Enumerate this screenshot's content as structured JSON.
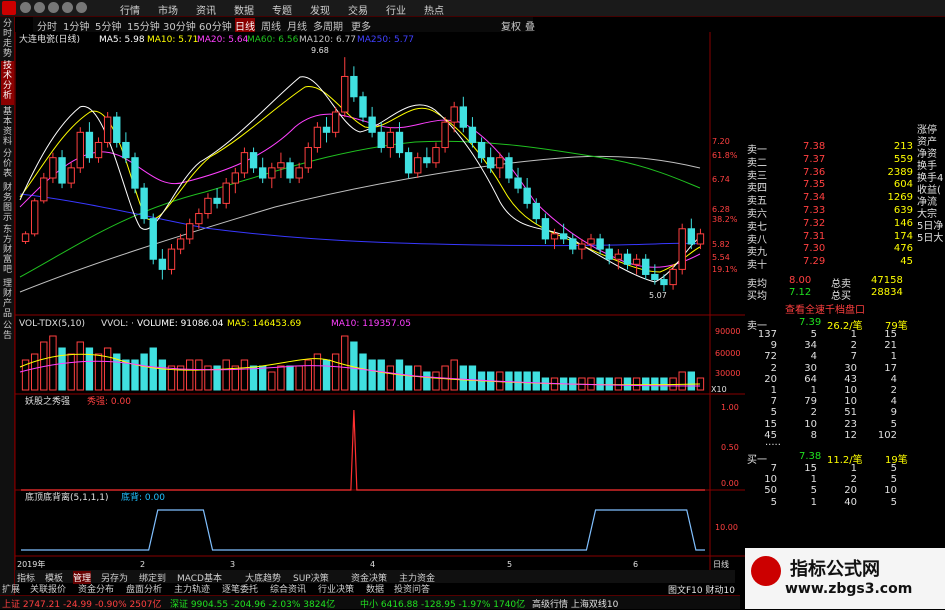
{
  "menubar": {
    "items": [
      "行情",
      "市场",
      "资讯",
      "数据",
      "专题",
      "发现",
      "交易",
      "行业",
      "热点"
    ]
  },
  "periods": {
    "items": [
      "分时",
      "1分钟",
      "5分钟",
      "15分钟",
      "30分钟",
      "60分钟",
      "日线",
      "周线",
      "月线",
      "多周期",
      "更多"
    ],
    "active": "日线",
    "right": [
      "复权",
      "叠"
    ]
  },
  "side_tabs": [
    "分时走势",
    "技术分析",
    "基本资料",
    "分价表",
    "财务图示",
    "东方财富吧",
    "理财产品",
    "公告"
  ],
  "main_chart": {
    "title": "大连电瓷(日线)",
    "ma": [
      {
        "label": "MA5: 5.98",
        "color": "#ffffff"
      },
      {
        "label": "MA10: 5.71",
        "color": "#ffff00"
      },
      {
        "label": "MA20: 5.64",
        "color": "#ff40ff"
      },
      {
        "label": "MA60: 6.56",
        "color": "#20c020"
      },
      {
        "label": "MA120: 6.77",
        "color": "#c0c0c0"
      },
      {
        "label": "MA250: 5.77",
        "color": "#4040ff"
      }
    ],
    "price_axis": [
      "7.20",
      "6.74",
      "6.28",
      "5.82",
      "5.54"
    ],
    "pct_axis": [
      "61.8%",
      "38.2%",
      "19.1%"
    ],
    "high_label": "9.68",
    "low_label": "5.07"
  },
  "volume_panel": {
    "title": "VOL-TDX(5,10)",
    "vvol": "VVOL: ·",
    "volume": "VOLUME: 91086.04",
    "ma5": "MA5: 146453.69",
    "ma10": "MA10: 119357.05",
    "axis": [
      "90000",
      "60000",
      "30000",
      "X10"
    ]
  },
  "panel2": {
    "title": "妖股之秀强",
    "value": "秀强: 0.00",
    "axis": [
      "1.00",
      "0.50",
      "0.00"
    ]
  },
  "panel3": {
    "title": "底顶底背离(5,1,1,1)",
    "value": "底背: 0.00",
    "axis": [
      "10.00"
    ]
  },
  "time_axis": {
    "labels": [
      "2019年",
      "2",
      "3",
      "4",
      "5",
      "6"
    ],
    "right": "日线"
  },
  "bottom_tabs": [
    "指标",
    "模板",
    "管理",
    "另存为",
    "绑定到",
    "MACD基本",
    "大底趋势",
    "SUP决策",
    "资金决策",
    "主力资金",
    "扩展",
    "关联报价",
    "资金分布",
    "盘面分析",
    "主力轨迹",
    "逐笔委托",
    "综合资讯",
    "行业决策",
    "数据",
    "投资问答"
  ],
  "right_panel": {
    "side_labels": [
      "涨停",
      "资产",
      "净资",
      "换手",
      "换手4",
      "收益(",
      "净流",
      "大宗",
      "5日净",
      "5日大"
    ],
    "sell": [
      {
        "label": "卖一",
        "price": "7.38",
        "vol": "213"
      },
      {
        "label": "卖二",
        "price": "7.37",
        "vol": "559"
      },
      {
        "label": "卖三",
        "price": "7.36",
        "vol": "2389"
      },
      {
        "label": "卖四",
        "price": "7.35",
        "vol": "604"
      },
      {
        "label": "卖五",
        "price": "7.34",
        "vol": "1269"
      },
      {
        "label": "卖六",
        "price": "7.33",
        "vol": "639"
      },
      {
        "label": "卖七",
        "price": "7.32",
        "vol": "146"
      },
      {
        "label": "卖八",
        "price": "7.31",
        "vol": "174"
      },
      {
        "label": "卖九",
        "price": "7.30",
        "vol": "476"
      },
      {
        "label": "卖十",
        "price": "7.29",
        "vol": "45"
      }
    ],
    "avg_sell": {
      "label": "卖均",
      "price": "8.00",
      "total_label": "总卖",
      "total": "47158"
    },
    "avg_buy": {
      "label": "买均",
      "price": "7.12",
      "total_label": "总买",
      "total": "28834"
    },
    "link": "查看全速千档盘口",
    "ask_header": {
      "label": "卖一",
      "price": "7.39",
      "frac": "26.2/笔",
      "count": "79笔"
    },
    "ask_queue": [
      [
        "137",
        "5",
        "1",
        "15"
      ],
      [
        "9",
        "34",
        "2",
        "21"
      ],
      [
        "72",
        "4",
        "7",
        "1"
      ],
      [
        "2",
        "30",
        "30",
        "17"
      ],
      [
        "20",
        "64",
        "43",
        "4"
      ],
      [
        "1",
        "1",
        "10",
        "2"
      ],
      [
        "7",
        "79",
        "10",
        "4"
      ],
      [
        "5",
        "2",
        "51",
        "9"
      ],
      [
        "15",
        "10",
        "23",
        "5"
      ],
      [
        "45",
        "8",
        "12",
        "102"
      ]
    ],
    "ellipsis": ".....",
    "bid_header": {
      "label": "买一",
      "price": "7.38",
      "frac": "11.2/笔",
      "count": "19笔"
    },
    "bid_queue": [
      [
        "7",
        "15",
        "1",
        "5"
      ],
      [
        "10",
        "1",
        "2",
        "5"
      ],
      [
        "50",
        "5",
        "20",
        "10"
      ],
      [
        "5",
        "1",
        "40",
        "5"
      ]
    ]
  },
  "status_bar": {
    "sh": "上证 2747.21 -24.99 -0.90% 2507亿",
    "sz": "深证 9904.55 -204.96 -2.03% 3824亿",
    "zx": "中小 6416.88 -128.95 -1.97% 1740亿",
    "right": "高级行情 上海双线10",
    "f10": "图文F10 财动10"
  },
  "watermark": {
    "title": "指标公式网",
    "url": "www.zbgs3.com"
  },
  "chart_data": {
    "type": "candlestick",
    "title": "大连电瓷(日线)",
    "ylim": [
      4.7,
      9.9
    ],
    "high": 9.68,
    "low": 5.07,
    "up_color": "#ff4040",
    "down_color": "#40e0e0",
    "ohlc": [
      [
        6.05,
        6.25,
        6.0,
        6.2
      ],
      [
        6.2,
        6.9,
        6.15,
        6.85
      ],
      [
        6.85,
        7.4,
        6.8,
        7.3
      ],
      [
        7.3,
        7.8,
        7.2,
        7.7
      ],
      [
        7.7,
        7.85,
        7.1,
        7.2
      ],
      [
        7.2,
        7.6,
        7.1,
        7.5
      ],
      [
        7.5,
        8.3,
        7.4,
        8.2
      ],
      [
        8.2,
        8.4,
        7.6,
        7.7
      ],
      [
        7.7,
        8.1,
        7.6,
        8.0
      ],
      [
        8.0,
        8.6,
        7.9,
        8.5
      ],
      [
        8.5,
        8.6,
        7.9,
        8.0
      ],
      [
        8.0,
        8.2,
        7.6,
        7.7
      ],
      [
        7.7,
        7.8,
        7.0,
        7.1
      ],
      [
        7.1,
        7.2,
        6.4,
        6.5
      ],
      [
        6.5,
        6.6,
        5.6,
        5.7
      ],
      [
        5.7,
        5.9,
        5.3,
        5.5
      ],
      [
        5.5,
        6.0,
        5.4,
        5.9
      ],
      [
        5.9,
        6.2,
        5.8,
        6.1
      ],
      [
        6.1,
        6.5,
        6.0,
        6.4
      ],
      [
        6.4,
        6.7,
        6.3,
        6.6
      ],
      [
        6.6,
        7.0,
        6.5,
        6.9
      ],
      [
        6.9,
        7.1,
        6.7,
        6.8
      ],
      [
        6.8,
        7.3,
        6.7,
        7.2
      ],
      [
        7.2,
        7.5,
        7.0,
        7.4
      ],
      [
        7.4,
        7.9,
        7.3,
        7.8
      ],
      [
        7.8,
        7.9,
        7.4,
        7.5
      ],
      [
        7.5,
        7.7,
        7.2,
        7.3
      ],
      [
        7.3,
        7.6,
        7.1,
        7.5
      ],
      [
        7.5,
        7.8,
        7.3,
        7.6
      ],
      [
        7.6,
        7.7,
        7.2,
        7.3
      ],
      [
        7.3,
        7.6,
        7.2,
        7.5
      ],
      [
        7.5,
        8.0,
        7.4,
        7.9
      ],
      [
        7.9,
        8.4,
        7.8,
        8.3
      ],
      [
        8.3,
        8.5,
        8.0,
        8.2
      ],
      [
        8.2,
        8.7,
        8.1,
        8.6
      ],
      [
        8.6,
        9.68,
        8.5,
        9.3
      ],
      [
        9.3,
        9.5,
        8.8,
        8.9
      ],
      [
        8.9,
        9.0,
        8.4,
        8.5
      ],
      [
        8.5,
        8.7,
        8.1,
        8.2
      ],
      [
        8.2,
        8.4,
        7.8,
        7.9
      ],
      [
        7.9,
        8.3,
        7.7,
        8.2
      ],
      [
        8.2,
        8.4,
        7.7,
        7.8
      ],
      [
        7.8,
        7.9,
        7.3,
        7.4
      ],
      [
        7.4,
        7.8,
        7.3,
        7.7
      ],
      [
        7.7,
        7.9,
        7.5,
        7.6
      ],
      [
        7.6,
        8.0,
        7.5,
        7.9
      ],
      [
        7.9,
        8.5,
        7.8,
        8.4
      ],
      [
        8.4,
        8.8,
        8.2,
        8.7
      ],
      [
        8.7,
        8.9,
        8.2,
        8.3
      ],
      [
        8.3,
        8.5,
        7.9,
        8.0
      ],
      [
        8.0,
        8.1,
        7.6,
        7.7
      ],
      [
        7.7,
        7.9,
        7.4,
        7.5
      ],
      [
        7.5,
        7.8,
        7.3,
        7.7
      ],
      [
        7.7,
        7.8,
        7.2,
        7.3
      ],
      [
        7.3,
        7.5,
        7.0,
        7.1
      ],
      [
        7.1,
        7.3,
        6.7,
        6.8
      ],
      [
        6.8,
        6.9,
        6.4,
        6.5
      ],
      [
        6.5,
        6.6,
        6.0,
        6.1
      ],
      [
        6.1,
        6.3,
        5.9,
        6.2
      ],
      [
        6.2,
        6.4,
        6.0,
        6.1
      ],
      [
        6.1,
        6.2,
        5.8,
        5.9
      ],
      [
        5.9,
        6.1,
        5.7,
        6.0
      ],
      [
        6.0,
        6.2,
        5.9,
        6.1
      ],
      [
        6.1,
        6.2,
        5.8,
        5.9
      ],
      [
        5.9,
        6.0,
        5.6,
        5.7
      ],
      [
        5.7,
        5.9,
        5.5,
        5.8
      ],
      [
        5.8,
        5.9,
        5.5,
        5.6
      ],
      [
        5.6,
        5.8,
        5.4,
        5.7
      ],
      [
        5.7,
        5.8,
        5.3,
        5.4
      ],
      [
        5.4,
        5.6,
        5.2,
        5.3
      ],
      [
        5.3,
        5.4,
        5.07,
        5.2
      ],
      [
        5.2,
        5.6,
        5.1,
        5.5
      ],
      [
        5.5,
        6.4,
        5.4,
        6.3
      ],
      [
        6.3,
        6.5,
        5.9,
        6.0
      ],
      [
        6.0,
        6.3,
        5.9,
        6.2
      ]
    ],
    "volume": [
      5,
      6,
      8,
      9,
      7,
      6,
      8,
      7,
      6,
      7,
      6,
      5,
      5,
      6,
      7,
      5,
      4,
      4,
      5,
      5,
      4,
      4,
      5,
      4,
      5,
      4,
      4,
      3,
      4,
      4,
      4,
      5,
      6,
      5,
      6,
      9,
      8,
      6,
      5,
      5,
      4,
      5,
      4,
      4,
      3,
      3,
      4,
      5,
      4,
      4,
      3,
      3,
      3,
      3,
      3,
      3,
      3,
      2,
      2,
      2,
      2,
      2,
      2,
      2,
      2,
      2,
      2,
      2,
      2,
      2,
      2,
      2,
      3,
      3,
      2
    ],
    "volume_unit": "x10000",
    "panel2_spike_index": 36,
    "panel3_plateaus": [
      [
        14,
        21
      ],
      [
        62,
        74
      ]
    ]
  }
}
